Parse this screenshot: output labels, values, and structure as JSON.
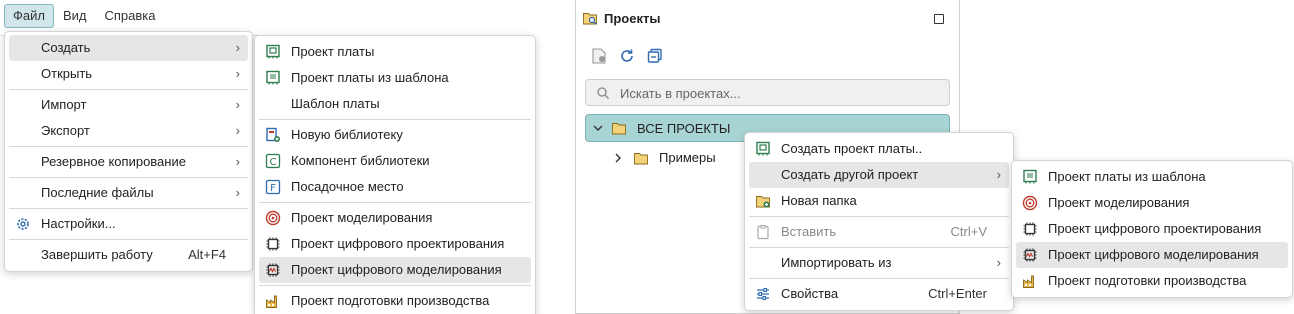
{
  "menubar": {
    "items": [
      "Файл",
      "Вид",
      "Справка"
    ]
  },
  "file_menu": {
    "create": "Создать",
    "open": "Открыть",
    "import": "Импорт",
    "export": "Экспорт",
    "backup": "Резервное копирование",
    "recent": "Последние файлы",
    "settings": "Настройки...",
    "exit": "Завершить работу",
    "exit_shortcut": "Alt+F4"
  },
  "create_submenu": {
    "board_project": "Проект платы",
    "board_from_template": "Проект платы из шаблона",
    "board_template": "Шаблон платы",
    "new_library": "Новую библиотеку",
    "library_component": "Компонент библиотеки",
    "footprint": "Посадочное место",
    "simulation_project": "Проект моделирования",
    "digital_design_project": "Проект цифрового проектирования",
    "digital_simulation_project": "Проект цифрового моделирования",
    "manufacturing_project": "Проект подготовки производства"
  },
  "projects_panel": {
    "title": "Проекты",
    "search_placeholder": "Искать в проектах...",
    "root": "ВСЕ ПРОЕКТЫ",
    "child": "Примеры"
  },
  "context_menu": {
    "create_board": "Создать проект платы..",
    "create_other": "Создать другой проект",
    "new_folder": "Новая папка",
    "paste": "Вставить",
    "paste_shortcut": "Ctrl+V",
    "import_from": "Импортировать из",
    "properties": "Свойства",
    "properties_shortcut": "Ctrl+Enter"
  },
  "other_project_submenu": {
    "board_from_template": "Проект платы из шаблона",
    "simulation": "Проект моделирования",
    "digital_design": "Проект цифрового проектирования",
    "digital_simulation": "Проект цифрового моделирования",
    "manufacturing": "Проект подготовки производства"
  },
  "colors": {
    "selection": "#a8d4d4",
    "highlight": "#e6e6e6",
    "menubar_active": "#cfe6ea",
    "icon_green": "#2e7d4f",
    "icon_blue": "#2f6bb0",
    "icon_red": "#c0392b",
    "icon_folder": "#e8b84a"
  }
}
